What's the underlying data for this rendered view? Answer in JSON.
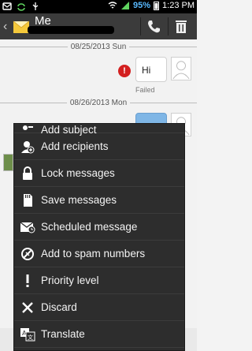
{
  "status_bar": {
    "battery_percent": "95%",
    "time": "1:23 PM"
  },
  "header": {
    "title": "Me"
  },
  "conversation": {
    "dates": [
      "08/25/2013 Sun",
      "08/26/2013 Mon"
    ],
    "message": {
      "text": "Hi",
      "status": "Failed"
    }
  },
  "menu": {
    "items": [
      {
        "label": "Add subject",
        "icon": "subject-icon"
      },
      {
        "label": "Add recipients",
        "icon": "add-recipient-icon"
      },
      {
        "label": "Lock messages",
        "icon": "lock-icon"
      },
      {
        "label": "Save messages",
        "icon": "sd-card-icon"
      },
      {
        "label": "Scheduled message",
        "icon": "scheduled-envelope-icon"
      },
      {
        "label": "Add to spam numbers",
        "icon": "spam-icon"
      },
      {
        "label": "Priority level",
        "icon": "exclamation-icon"
      },
      {
        "label": "Discard",
        "icon": "discard-x-icon"
      },
      {
        "label": "Translate",
        "icon": "translate-icon"
      }
    ]
  },
  "colors": {
    "status_bar": "#000000",
    "title_bar": "#3b3b3b",
    "menu_bg": "#2d2d2d",
    "battery_text": "#58b9ff",
    "failed_badge": "#d32020"
  }
}
